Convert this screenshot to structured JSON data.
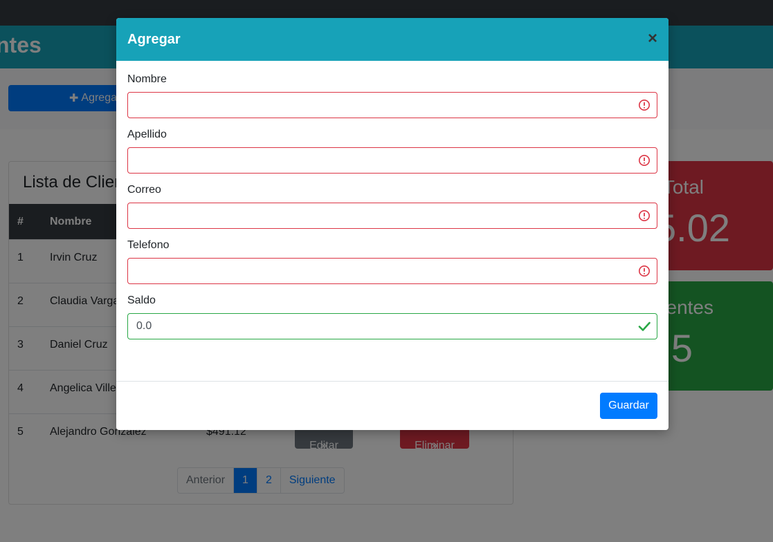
{
  "hero": {
    "title_visible": "ntes"
  },
  "toolbar": {
    "add_label": "Agrega"
  },
  "list": {
    "title": "Lista de Clien",
    "headers": [
      "#",
      "Nombre"
    ],
    "rows": [
      {
        "num": "1",
        "name": "Irvin Cruz"
      },
      {
        "num": "2",
        "name": "Claudia Varga"
      },
      {
        "num": "3",
        "name": "Daniel Cruz"
      },
      {
        "num": "4",
        "name": "Angelica Ville"
      },
      {
        "num": "5",
        "name": "Alejandro Gonzalez",
        "amount": "$491.12",
        "edit_label": "Editar",
        "delete_label": "Eliminar"
      }
    ],
    "pagination": [
      "Anterior",
      "1",
      "2",
      "Siguiente"
    ]
  },
  "stats": {
    "total_label": "Total",
    "total_value": "5.02",
    "clients_label": "entes",
    "clients_value": "5"
  },
  "modal": {
    "title": "Agregar",
    "close_glyph": "×",
    "fields": [
      {
        "label": "Nombre",
        "value": "",
        "state": "invalid"
      },
      {
        "label": "Apellido",
        "value": "",
        "state": "invalid"
      },
      {
        "label": "Correo",
        "value": "",
        "state": "invalid"
      },
      {
        "label": "Telefono",
        "value": "",
        "state": "invalid"
      },
      {
        "label": "Saldo",
        "value": "0.0",
        "state": "valid"
      }
    ],
    "save_label": "Guardar"
  },
  "colors": {
    "header": "#17a2b8",
    "invalid": "#dc3545",
    "valid": "#28a745",
    "primary": "#007bff"
  },
  "icons": {
    "invalid": "exclamation-circle-icon",
    "valid": "check-icon"
  }
}
